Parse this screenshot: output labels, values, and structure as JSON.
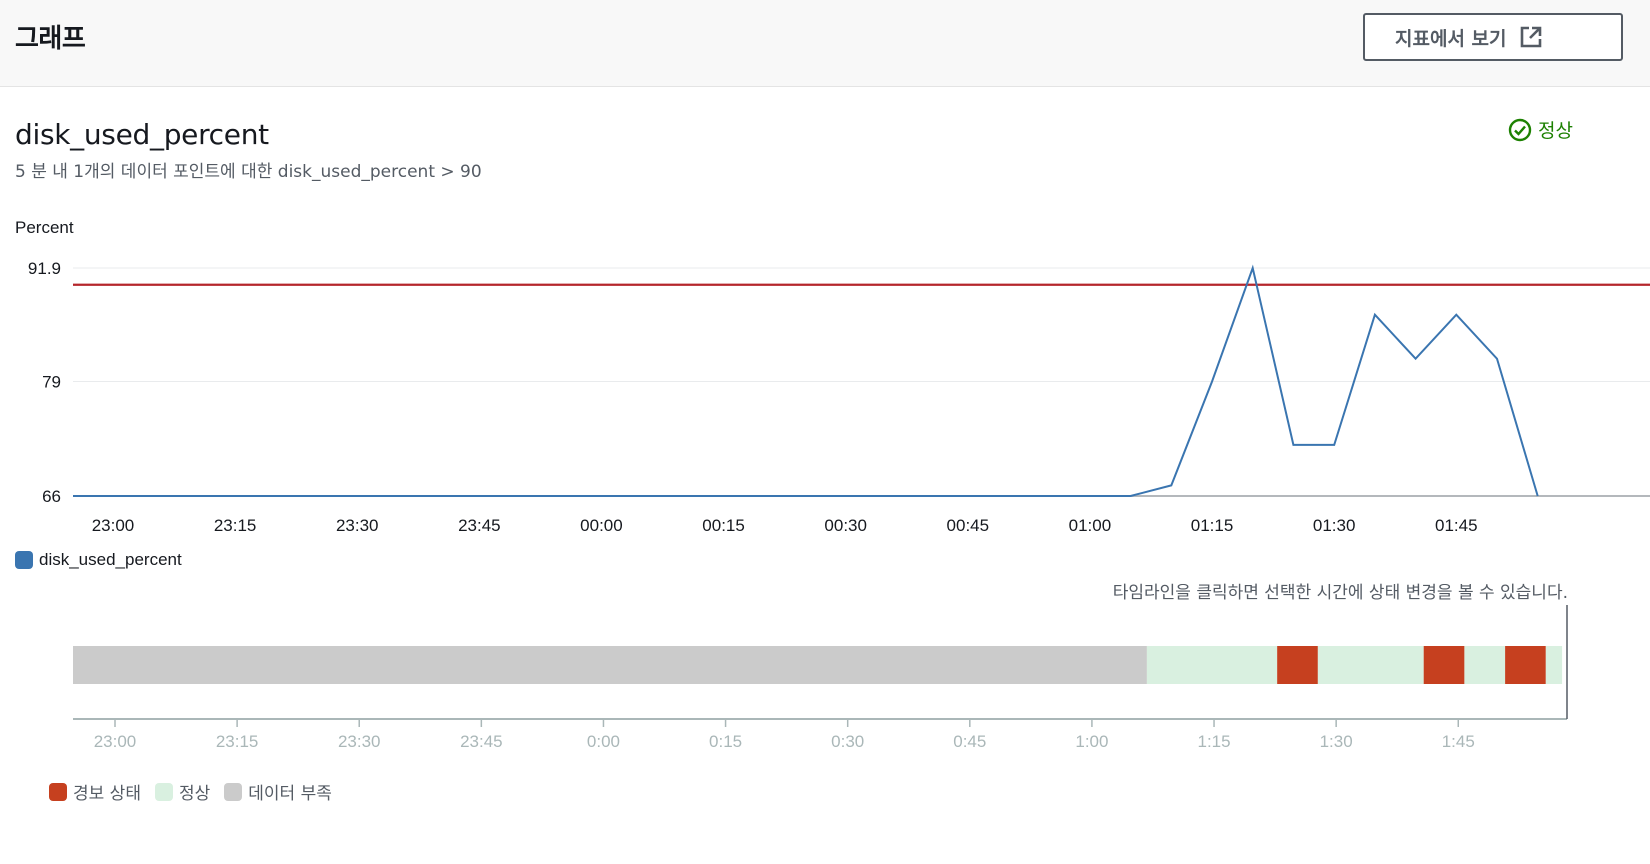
{
  "header": {
    "title": "그래프",
    "view_button_label": "지표에서 보기"
  },
  "metric": {
    "title": "disk_used_percent",
    "description": "5 분 내 1개의 데이터 포인트에 대한 disk_used_percent > 90",
    "status": "정상"
  },
  "colors": {
    "series": "#3a75b0",
    "threshold": "#b5262b",
    "alarm": "#c6401f",
    "ok": "#d9f0e0",
    "insufficient": "#cbcbcb",
    "status_ok": "#1d8102"
  },
  "chart_data": {
    "type": "line",
    "ylabel": "Percent",
    "y_ticks": [
      "91.9",
      "79",
      "66"
    ],
    "ylim": [
      66,
      91.9
    ],
    "x_tick_labels": [
      "23:00",
      "23:15",
      "23:30",
      "23:45",
      "00:00",
      "00:15",
      "00:30",
      "00:45",
      "01:00",
      "01:15",
      "01:30",
      "01:45"
    ],
    "threshold": 90,
    "series": [
      {
        "name": "disk_used_percent",
        "x": [
          "23:00",
          "01:05",
          "01:10",
          "01:15",
          "01:20",
          "01:25",
          "01:30",
          "01:35",
          "01:40",
          "01:45",
          "01:50",
          "01:55"
        ],
        "values": [
          66,
          66,
          67.2,
          79,
          91.9,
          71.8,
          71.8,
          86.6,
          81.6,
          86.6,
          81.6,
          66
        ]
      }
    ]
  },
  "timeline": {
    "hint": "타임라인을 클릭하면 선택한 시간에 상태 변경을 볼 수 있습니다.",
    "tick_labels": [
      "23:00",
      "23:15",
      "23:30",
      "23:45",
      "0:00",
      "0:15",
      "0:30",
      "0:45",
      "1:00",
      "1:15",
      "1:30",
      "1:45"
    ],
    "segments": [
      {
        "state": "insufficient",
        "start": "22:55",
        "end": "01:07"
      },
      {
        "state": "ok",
        "start": "01:07",
        "end": "01:23"
      },
      {
        "state": "alarm",
        "start": "01:23",
        "end": "01:28"
      },
      {
        "state": "ok",
        "start": "01:28",
        "end": "01:41"
      },
      {
        "state": "alarm",
        "start": "01:41",
        "end": "01:46"
      },
      {
        "state": "ok",
        "start": "01:46",
        "end": "01:51"
      },
      {
        "state": "alarm",
        "start": "01:51",
        "end": "01:56"
      },
      {
        "state": "ok",
        "start": "01:56",
        "end": "01:58"
      }
    ],
    "legend": [
      {
        "state": "alarm",
        "label": "경보 상태"
      },
      {
        "state": "ok",
        "label": "정상"
      },
      {
        "state": "insufficient",
        "label": "데이터 부족"
      }
    ]
  }
}
